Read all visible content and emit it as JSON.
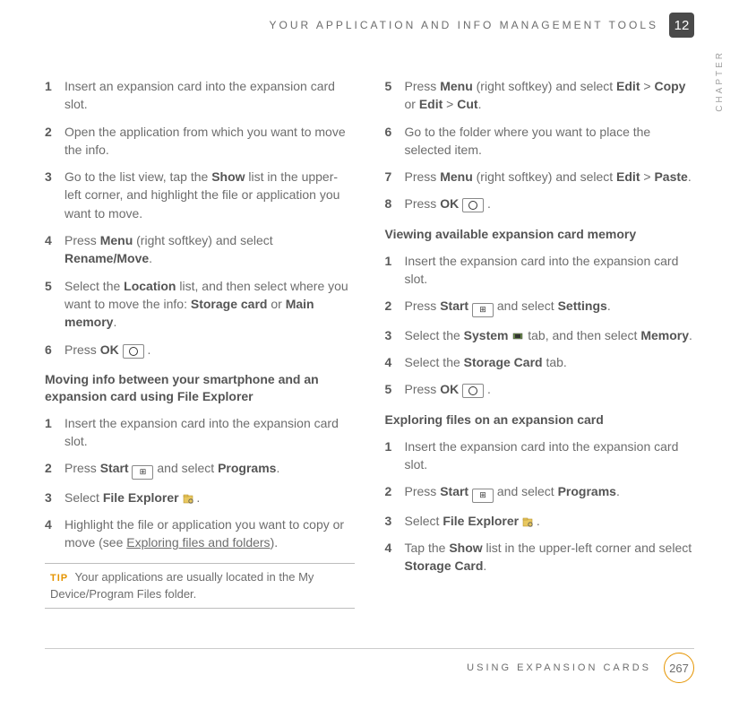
{
  "header": {
    "title": "YOUR APPLICATION AND INFO MANAGEMENT TOOLS",
    "chapter_number": "12",
    "chapter_label": "CHAPTER"
  },
  "left": {
    "steps_a": [
      {
        "n": "1",
        "body": "Insert an expansion card into the expansion card slot."
      },
      {
        "n": "2",
        "body": "Open the application from which you want to move the info."
      },
      {
        "n": "3",
        "pre": "Go to the list view, tap the ",
        "b1": "Show",
        "post": " list in the upper-left corner, and highlight the file or application you want to move."
      },
      {
        "n": "4",
        "pre": "Press ",
        "b1": "Menu",
        "mid": " (right softkey) and select ",
        "b2": "Rename/Move",
        "post": "."
      },
      {
        "n": "5",
        "pre": "Select the ",
        "b1": "Location",
        "mid": " list, and then select where you want to move the info: ",
        "b2": "Storage card",
        "mid2": " or ",
        "b3": "Main memory",
        "post": "."
      },
      {
        "n": "6",
        "pre": "Press ",
        "b1": "OK",
        "icon": "ok",
        "post": "."
      }
    ],
    "heading_b": "Moving info between your smartphone and an expansion card using File Explorer",
    "steps_b": [
      {
        "n": "1",
        "body": "Insert the expansion card into the expansion card slot."
      },
      {
        "n": "2",
        "pre": "Press ",
        "b1": "Start",
        "icon": "win",
        "mid": " and select ",
        "b2": "Programs",
        "post": "."
      },
      {
        "n": "3",
        "pre": "Select ",
        "b1": "File Explorer",
        "icon": "folder",
        "post": "."
      },
      {
        "n": "4",
        "pre": "Highlight the file or application you want to copy or move (see ",
        "u": "Exploring files and folders",
        "post": ")."
      }
    ],
    "tip": {
      "label": "TIP",
      "text": "Your applications are usually located in the My Device/Program Files folder."
    }
  },
  "right": {
    "steps_a": [
      {
        "n": "5",
        "pre": "Press ",
        "b1": "Menu",
        "mid": " (right softkey) and select ",
        "b2": "Edit",
        "mid2": " > ",
        "b3": "Copy",
        "mid3": " or ",
        "b4": "Edit",
        "mid4": " > ",
        "b5": "Cut",
        "post": "."
      },
      {
        "n": "6",
        "body": "Go to the folder where you want to place the selected item."
      },
      {
        "n": "7",
        "pre": "Press ",
        "b1": "Menu",
        "mid": " (right softkey) and select ",
        "b2": "Edit",
        "mid2": " > ",
        "b3": "Paste",
        "post": "."
      },
      {
        "n": "8",
        "pre": "Press ",
        "b1": "OK",
        "icon": "ok",
        "post": "."
      }
    ],
    "heading_b": "Viewing available expansion card memory",
    "steps_b": [
      {
        "n": "1",
        "body": "Insert the expansion card into the expansion card slot."
      },
      {
        "n": "2",
        "pre": "Press ",
        "b1": "Start",
        "icon": "win",
        "mid": " and select ",
        "b2": "Settings",
        "post": "."
      },
      {
        "n": "3",
        "pre": "Select the ",
        "b1": "System",
        "mid": " tab, and then select ",
        "b2": "Memory",
        "icon": "chip",
        "post": "."
      },
      {
        "n": "4",
        "pre": "Select the ",
        "b1": "Storage Card",
        "post": " tab."
      },
      {
        "n": "5",
        "pre": "Press ",
        "b1": "OK",
        "icon": "ok",
        "post": "."
      }
    ],
    "heading_c": "Exploring files on an expansion card",
    "steps_c": [
      {
        "n": "1",
        "body": "Insert the expansion card into the expansion card slot."
      },
      {
        "n": "2",
        "pre": "Press ",
        "b1": "Start",
        "icon": "win",
        "mid": " and select ",
        "b2": "Programs",
        "post": "."
      },
      {
        "n": "3",
        "pre": "Select ",
        "b1": "File Explorer",
        "icon": "folder",
        "post": "."
      },
      {
        "n": "4",
        "pre": "Tap the ",
        "b1": "Show",
        "mid": " list in the upper-left corner and select ",
        "b2": "Storage Card",
        "post": "."
      }
    ]
  },
  "footer": {
    "label": "USING EXPANSION CARDS",
    "page": "267"
  }
}
